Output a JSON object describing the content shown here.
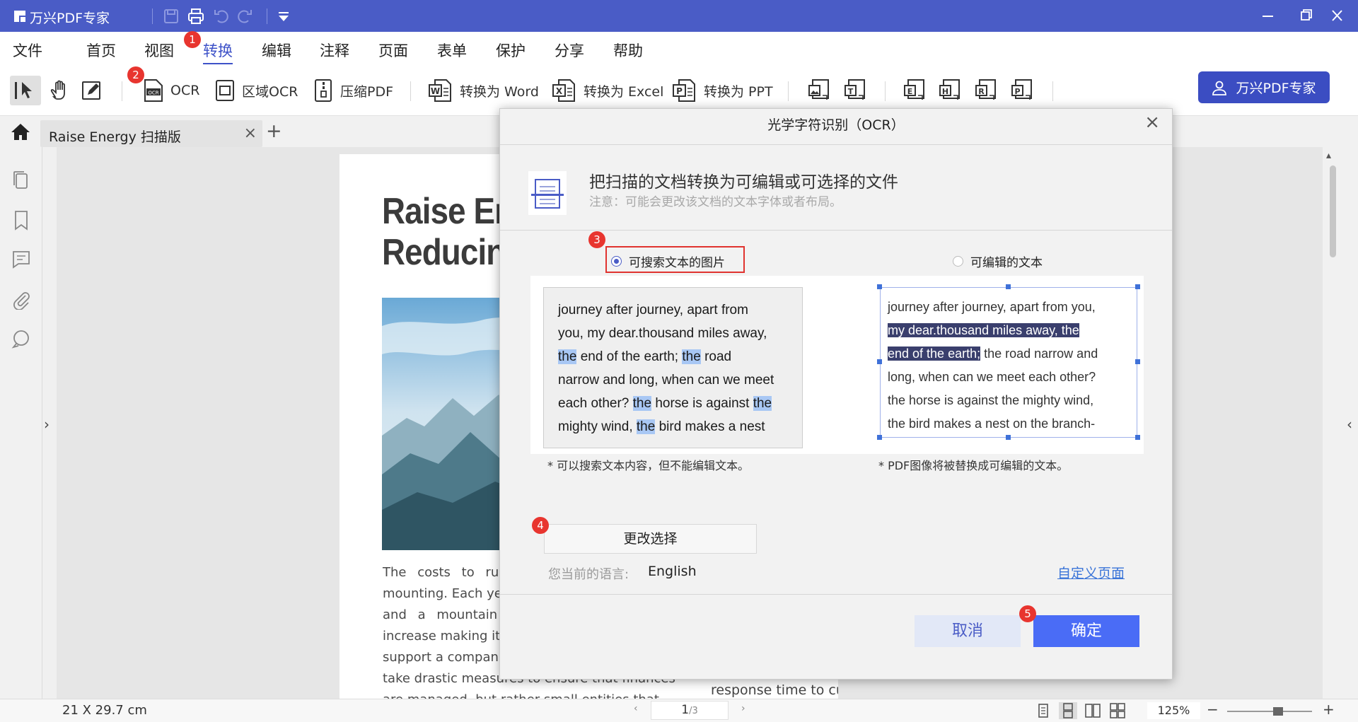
{
  "app": {
    "title": "万兴PDF专家"
  },
  "menu": {
    "items": [
      "文件",
      "首页",
      "视图",
      "转换",
      "编辑",
      "注释",
      "页面",
      "表单",
      "保护",
      "分享",
      "帮助"
    ],
    "active": "转换"
  },
  "toolbar": {
    "ocr_label": "OCR",
    "area_ocr_label": "区域OCR",
    "compress_label": "压缩PDF",
    "to_word_label": "转换为 Word",
    "to_excel_label": "转换为 Excel",
    "to_ppt_label": "转换为 PPT",
    "brand_button": "万兴PDF专家"
  },
  "tab": {
    "doc_name": "Raise Energy 扫描版",
    "close": "×",
    "add": "+"
  },
  "document": {
    "title_lines": [
      "Raise En",
      "Reducin"
    ],
    "body_lines": [
      "The costs to run",
      "mounting. Each ye",
      "and a mountain",
      "increase making it",
      "support a compan",
      "take drastic measures to ensure that finances",
      "are managed, but rather small entities that"
    ],
    "right_line": "response time to customers as all work orders"
  },
  "dialog": {
    "title": "光学字符识别（OCR）",
    "close": "×",
    "heading": "把扫描的文档转换为可编辑或可选择的文件",
    "note": "注意：可能会更改该文档的文本字体或者布局。",
    "option_searchable": "可搜索文本的图片",
    "option_editable": "可编辑的文本",
    "selected_option": "可搜索文本的图片",
    "caption_searchable": "* 可以搜索文本内容，但不能编辑文本。",
    "caption_editable": "* PDF图像将被替换成可编辑的文本。",
    "change_button": "更改选择",
    "language_label": "您当前的语言:",
    "language_value": "English",
    "custom_link": "自定义页面",
    "cancel_button": "取消",
    "ok_button": "确定",
    "preview_searchable": [
      [
        [
          "journey after journey, apart from",
          ""
        ]
      ],
      [
        [
          "you, my dear.thousand miles away,",
          ""
        ]
      ],
      [
        [
          "the",
          "hl"
        ],
        [
          " end of the earth; ",
          ""
        ],
        [
          "the",
          "hl"
        ],
        [
          " road",
          ""
        ]
      ],
      [
        [
          "narrow and long, when can we meet",
          ""
        ]
      ],
      [
        [
          "each other? ",
          ""
        ],
        [
          "the",
          "hl"
        ],
        [
          " horse is against ",
          ""
        ],
        [
          "the",
          "hl"
        ]
      ],
      [
        [
          "mighty wind, ",
          ""
        ],
        [
          "the",
          "hl"
        ],
        [
          " bird makes a nest",
          ""
        ]
      ]
    ],
    "preview_editable": [
      [
        [
          "journey after journey, apart from you,",
          ""
        ]
      ],
      [
        [
          "my dear.thousand miles away, the ",
          "sel"
        ]
      ],
      [
        [
          "end of the earth;",
          "sel"
        ],
        [
          " the road narrow and",
          ""
        ]
      ],
      [
        [
          "long, when can we meet each other?",
          ""
        ]
      ],
      [
        [
          "the horse is against the mighty wind,",
          ""
        ]
      ],
      [
        [
          "the bird makes a nest on the branch-",
          ""
        ]
      ]
    ]
  },
  "badges": [
    "1",
    "2",
    "3",
    "4",
    "5"
  ],
  "statusbar": {
    "page_size": "21 X 29.7 cm",
    "current_page": "1",
    "total_pages": "/3",
    "zoom": "125%",
    "prev": "‹",
    "next": "›",
    "minus": "−",
    "plus": "+"
  },
  "colors": {
    "brand": "#4a5cc6",
    "accent": "#3e52c8",
    "ok_button": "#4a6cf6",
    "highlight": "#a8c7f4",
    "annotation_red": "#e8352f"
  }
}
